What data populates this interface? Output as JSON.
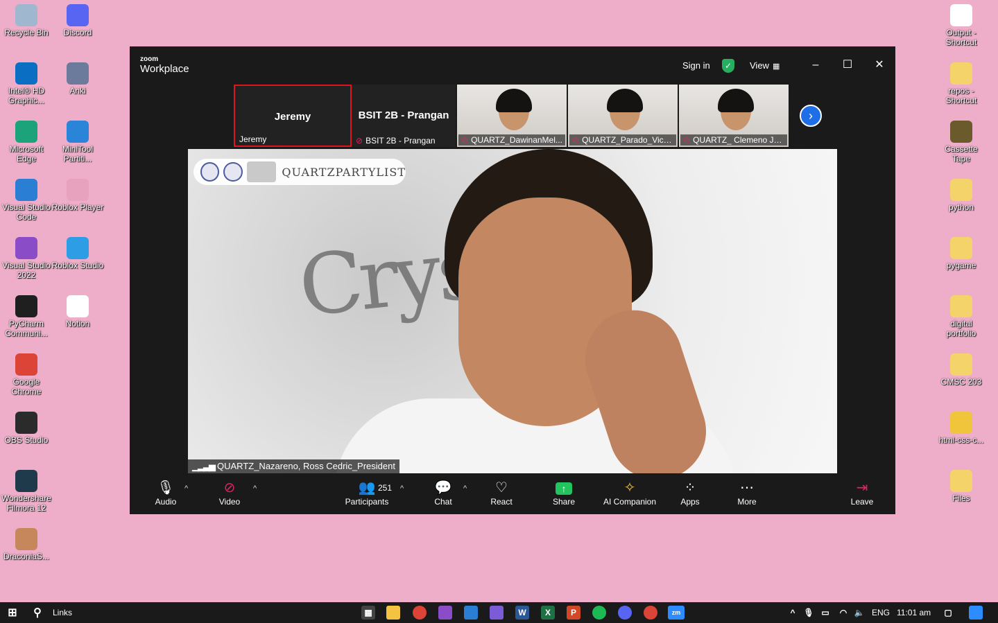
{
  "desktop_left": [
    {
      "label": "Recycle Bin",
      "icon": "recycle-bin-icon",
      "color": "#9fb8cf"
    },
    {
      "label": "Discord",
      "icon": "discord-icon",
      "color": "#5865f2"
    },
    {
      "label": "Intel® HD Graphic...",
      "icon": "intel-graphics-icon",
      "color": "#0a6fc2"
    },
    {
      "label": "Anki",
      "icon": "anki-icon",
      "color": "#6c7a9c"
    },
    {
      "label": "Microsoft Edge",
      "icon": "edge-icon",
      "color": "#1da37a"
    },
    {
      "label": "MiniTool Partiti...",
      "icon": "minitool-icon",
      "color": "#2a84d8"
    },
    {
      "label": "Visual Studio Code",
      "icon": "vscode-icon",
      "color": "#2a7ed3"
    },
    {
      "label": "Roblox Player",
      "icon": "roblox-player-icon",
      "color": "#e7a2bd"
    },
    {
      "label": "Visual Studio 2022",
      "icon": "visual-studio-icon",
      "color": "#8a4cc7"
    },
    {
      "label": "Roblox Studio",
      "icon": "roblox-studio-icon",
      "color": "#2d9de6"
    },
    {
      "label": "PyCharm Communi...",
      "icon": "pycharm-icon",
      "color": "#1f1f1f"
    },
    {
      "label": "Notion",
      "icon": "notion-icon",
      "color": "#ffffff"
    },
    {
      "label": "Google Chrome",
      "icon": "chrome-icon",
      "color": "#db4437"
    },
    {
      "label": "OBS Studio",
      "icon": "obs-icon",
      "color": "#2b2b2b"
    },
    {
      "label": "Wondershare Filmora 12",
      "icon": "filmora-icon",
      "color": "#1f3a4a"
    },
    {
      "label": "DraconiaS...",
      "icon": "draconia-icon",
      "color": "#c7875c"
    }
  ],
  "desktop_right": [
    {
      "label": "Output - Shortcut",
      "icon": "shortcut-icon",
      "color": "#ffffff"
    },
    {
      "label": "repos - Shortcut",
      "icon": "folder-shortcut-icon",
      "color": "#f5d36b"
    },
    {
      "label": "Cassette Tape",
      "icon": "file-icon",
      "color": "#6b5a2c"
    },
    {
      "label": "python",
      "icon": "folder-icon",
      "color": "#f5d36b"
    },
    {
      "label": "pygame",
      "icon": "folder-icon",
      "color": "#f5d36b"
    },
    {
      "label": "digital portfolio",
      "icon": "folder-icon",
      "color": "#f5d36b"
    },
    {
      "label": "CMSC 203",
      "icon": "folder-icon",
      "color": "#f5d36b"
    },
    {
      "label": "html-css-c...",
      "icon": "html-file-icon",
      "color": "#f0c43b"
    },
    {
      "label": "Files",
      "icon": "folder-icon",
      "color": "#f5d36b"
    }
  ],
  "zoom": {
    "brand_small": "zoom",
    "brand_big": "Workplace",
    "sign_in": "Sign in",
    "view": "View",
    "thumbnails": [
      {
        "center_name": "Jeremy",
        "tag": "Jeremy",
        "muted": false,
        "video": false,
        "active": true
      },
      {
        "center_name": "BSIT 2B - Prangan",
        "tag": "BSIT 2B - Prangan",
        "muted": true,
        "video": false,
        "active": false
      },
      {
        "center_name": "",
        "tag": "QUARTZ_DawinanMel...",
        "muted": true,
        "video": true,
        "active": false
      },
      {
        "center_name": "",
        "tag": "QUARTZ_Parado_Vice...",
        "muted": true,
        "video": true,
        "active": false
      },
      {
        "center_name": "",
        "tag": "QUARTZ_ Clemeno Ja...",
        "muted": true,
        "video": true,
        "active": false
      }
    ],
    "main_video": {
      "banner_text": "QUARTZPARTYLIST",
      "name": "QUARTZ_Nazareno, Ross Cedric_President"
    },
    "toolbar": {
      "audio": "Audio",
      "video": "Video",
      "participants": "Participants",
      "participant_count": "251",
      "chat": "Chat",
      "react": "React",
      "share": "Share",
      "ai_companion": "AI Companion",
      "apps": "Apps",
      "more": "More",
      "leave": "Leave"
    }
  },
  "taskbar": {
    "search_label": "Links",
    "lang": "ENG",
    "time": "11:01 am"
  },
  "colors": {
    "desktop": "#eeadc8",
    "zoom_bg": "#1a1a1a",
    "active_border": "#e0141e",
    "share_green": "#21c45d",
    "shield_green": "#27ae60",
    "leave_red": "#e0245e"
  }
}
